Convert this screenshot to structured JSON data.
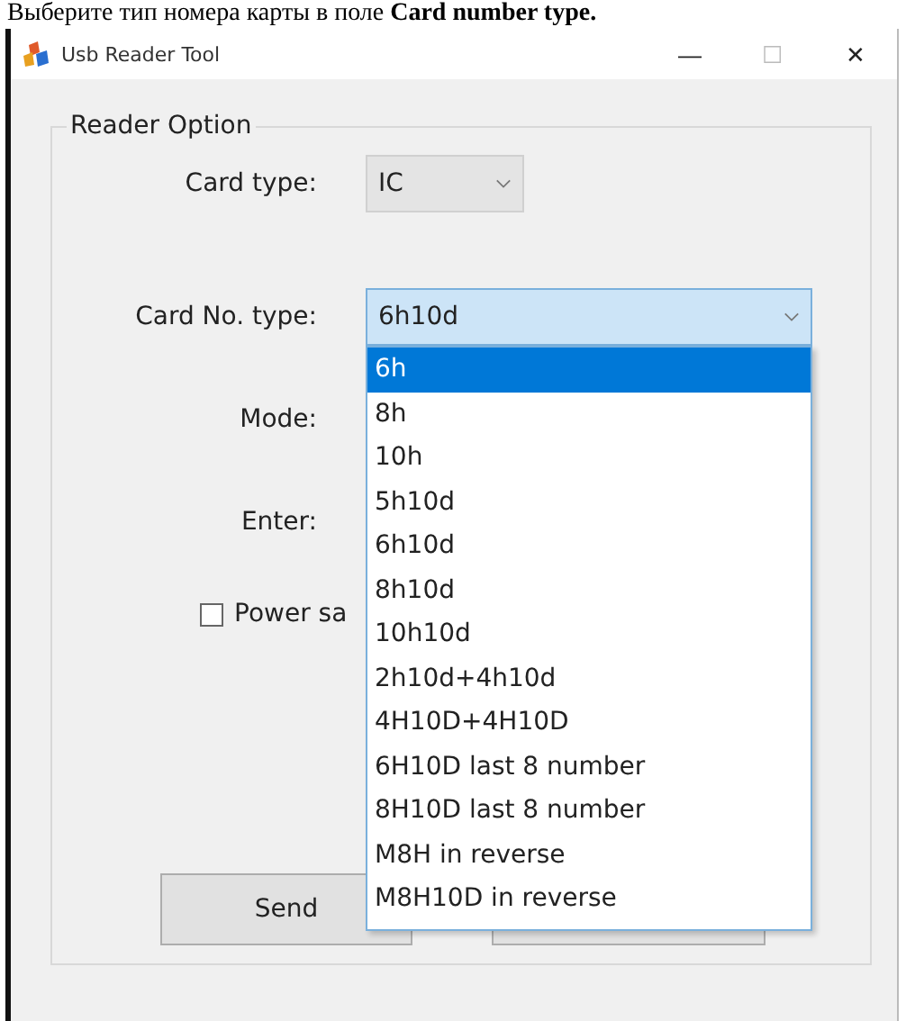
{
  "caption": "Выберите тип номера карты в поле **Card number type.**",
  "window": {
    "title": "Usb Reader Tool",
    "buttons": [
      "—",
      "☐",
      "✕"
    ]
  },
  "group": {
    "title": "Reader Option"
  },
  "fields": [
    {
      "label": "Card type:",
      "value": "IC",
      "kind": "combo"
    },
    {
      "label": "Card No. type:",
      "value": "6h10d",
      "kind": "combo-open"
    },
    {
      "label": "Mode:",
      "kind": "hidden"
    },
    {
      "label": "Enter:",
      "kind": "hidden"
    }
  ],
  "power_saving": {
    "label": "Power sa",
    "checked": false
  },
  "dropdown": {
    "items": [
      {
        "label": "6h",
        "selected": true
      },
      {
        "label": "8h",
        "selected": false
      },
      {
        "label": "10h",
        "selected": false
      },
      {
        "label": "5h10d",
        "selected": false
      },
      {
        "label": "6h10d",
        "selected": false
      },
      {
        "label": "8h10d",
        "selected": false
      },
      {
        "label": "10h10d",
        "selected": false
      },
      {
        "label": "2h10d+4h10d",
        "selected": false
      },
      {
        "label": "4H10D+4H10D",
        "selected": false
      },
      {
        "label": "6H10D last 8 number",
        "selected": false
      },
      {
        "label": "8H10D last 8 number",
        "selected": false
      },
      {
        "label": "M8H in reverse",
        "selected": false
      },
      {
        "label": "M8H10D in reverse",
        "selected": false
      }
    ]
  },
  "buttons": [
    {
      "label": "Send"
    }
  ]
}
